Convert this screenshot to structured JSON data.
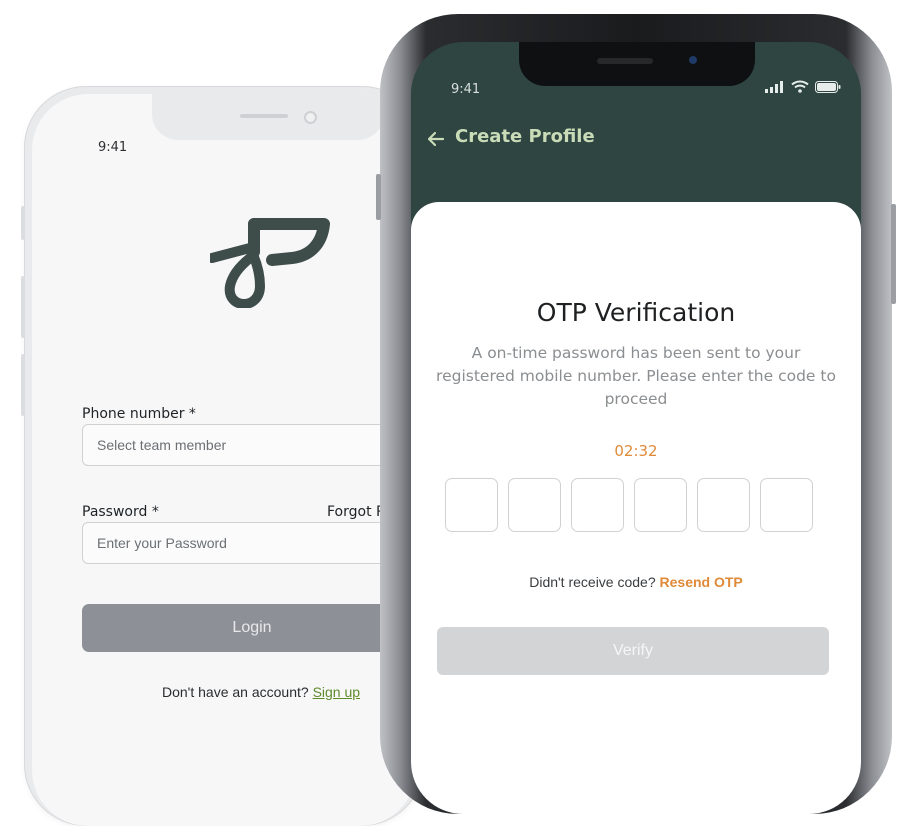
{
  "login_phone": {
    "status_time": "9:41",
    "phone_label": "Phone number *",
    "phone_placeholder": "Select team member",
    "password_label": "Password *",
    "forgot_label": "Forgot P",
    "password_placeholder": "Enter your Password",
    "login_label": "Login",
    "signup_prompt": "Don't have an account?",
    "signup_link": "Sign up",
    "logo_icon": "bird-logo-icon"
  },
  "otp_phone": {
    "status_time": "9:41",
    "status_icons": [
      "signal-icon",
      "wifi-icon",
      "battery-icon"
    ],
    "header_title": "Create Profile",
    "back_icon": "arrow-left-icon",
    "title": "OTP Verification",
    "description": "A on-time password has been sent to your registered mobile number. Please enter the code to proceed",
    "timer": "02:32",
    "otp_digits": [
      "",
      "",
      "",
      "",
      "",
      ""
    ],
    "resend_prompt": "Didn't receive code?",
    "resend_link": "Resend OTP",
    "verify_label": "Verify"
  },
  "colors": {
    "header_bg": "#2f4541",
    "header_title": "#c9dcb7",
    "accent_orange": "#e08a38",
    "signup_green": "#5f8a2c",
    "login_button": "#8d9197",
    "verify_button": "#d3d4d6"
  }
}
